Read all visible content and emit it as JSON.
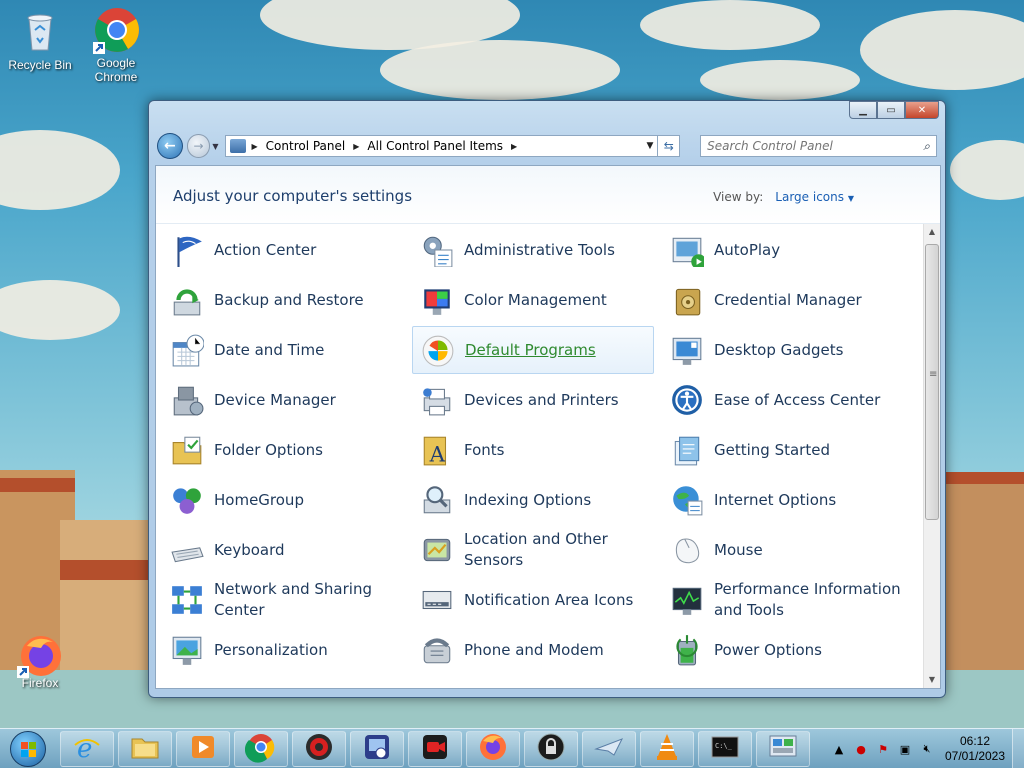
{
  "desktop": {
    "icons": [
      {
        "label": "Recycle Bin",
        "icon": "recycle-bin-icon"
      },
      {
        "label": "Google Chrome",
        "icon": "chrome-icon"
      },
      {
        "label": "Firefox",
        "icon": "firefox-icon"
      }
    ]
  },
  "window": {
    "breadcrumb": [
      "Control Panel",
      "All Control Panel Items"
    ],
    "search_placeholder": "Search Control Panel",
    "heading": "Adjust your computer's settings",
    "view_by_label": "View by:",
    "view_by_value": "Large icons",
    "items": [
      {
        "label": "Action Center",
        "icon": "flag-icon"
      },
      {
        "label": "Administrative Tools",
        "icon": "admin-tools-icon"
      },
      {
        "label": "AutoPlay",
        "icon": "autoplay-icon"
      },
      {
        "label": "Backup and Restore",
        "icon": "backup-icon"
      },
      {
        "label": "Color Management",
        "icon": "color-management-icon"
      },
      {
        "label": "Credential Manager",
        "icon": "vault-icon"
      },
      {
        "label": "Date and Time",
        "icon": "calendar-clock-icon"
      },
      {
        "label": "Default Programs",
        "icon": "windows-check-icon"
      },
      {
        "label": "Desktop Gadgets",
        "icon": "gadgets-icon"
      },
      {
        "label": "Device Manager",
        "icon": "device-manager-icon"
      },
      {
        "label": "Devices and Printers",
        "icon": "printer-icon"
      },
      {
        "label": "Ease of Access Center",
        "icon": "ease-of-access-icon"
      },
      {
        "label": "Folder Options",
        "icon": "folder-icon"
      },
      {
        "label": "Fonts",
        "icon": "fonts-icon"
      },
      {
        "label": "Getting Started",
        "icon": "getting-started-icon"
      },
      {
        "label": "HomeGroup",
        "icon": "homegroup-icon"
      },
      {
        "label": "Indexing Options",
        "icon": "indexing-icon"
      },
      {
        "label": "Internet Options",
        "icon": "globe-icon"
      },
      {
        "label": "Keyboard",
        "icon": "keyboard-icon"
      },
      {
        "label": "Location and Other Sensors",
        "icon": "gps-icon"
      },
      {
        "label": "Mouse",
        "icon": "mouse-icon"
      },
      {
        "label": "Network and Sharing Center",
        "icon": "network-icon"
      },
      {
        "label": "Notification Area Icons",
        "icon": "notification-icon"
      },
      {
        "label": "Performance Information and Tools",
        "icon": "performance-icon"
      },
      {
        "label": "Personalization",
        "icon": "personalization-icon"
      },
      {
        "label": "Phone and Modem",
        "icon": "phone-icon"
      },
      {
        "label": "Power Options",
        "icon": "power-icon"
      }
    ],
    "highlighted_index": 7
  },
  "taskbar": {
    "pinned": [
      "internet-explorer-icon",
      "file-explorer-icon",
      "media-player-icon",
      "chrome-icon",
      "app-red-icon",
      "remote-icon",
      "recorder-icon",
      "firefox-icon",
      "lock-icon",
      "plane-icon",
      "vlc-icon",
      "cmd-icon",
      "control-panel-icon"
    ],
    "time": "06:12",
    "date": "07/01/2023",
    "accent": "#6ea0be"
  }
}
